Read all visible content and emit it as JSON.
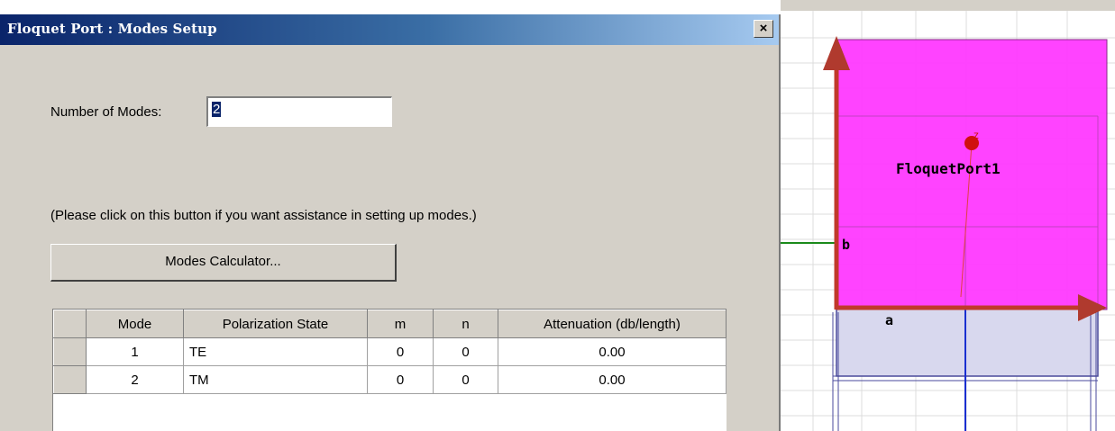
{
  "dialog": {
    "title": "Floquet Port : Modes Setup",
    "close_glyph": "×",
    "number_of_modes_label": "Number of Modes:",
    "number_of_modes_value": "2",
    "assist_text": "(Please click on this button if you want assistance in setting up modes.)",
    "calculator_button": "Modes Calculator...",
    "table": {
      "columns": [
        "Mode",
        "Polarization State",
        "m",
        "n",
        "Attenuation (db/length)"
      ],
      "rows": [
        {
          "mode": "1",
          "polarization": "TE",
          "m": "0",
          "n": "0",
          "attenuation": "0.00"
        },
        {
          "mode": "2",
          "polarization": "TM",
          "m": "0",
          "n": "0",
          "attenuation": "0.00"
        }
      ]
    }
  },
  "viewport": {
    "port_label": "FloquetPort1",
    "axis_a": "a",
    "axis_b": "b",
    "axis_z": "z",
    "colors": {
      "port_fill": "#ff33ff",
      "vector": "#c0392b",
      "box_edge": "#4a4a9c"
    }
  }
}
